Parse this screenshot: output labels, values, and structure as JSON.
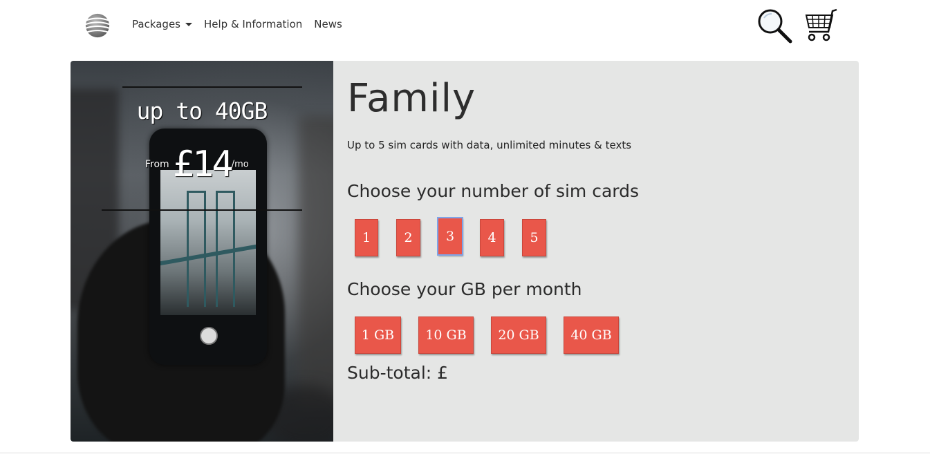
{
  "nav": {
    "logo": "att-globe-logo",
    "links": [
      {
        "label": "Packages",
        "has_dropdown": true
      },
      {
        "label": "Help & Information",
        "has_dropdown": false
      },
      {
        "label": "News",
        "has_dropdown": false
      }
    ],
    "icons": [
      "search-icon",
      "cart-icon"
    ]
  },
  "hero": {
    "headline": "up to 40GB",
    "from_label": "From",
    "price": "£14",
    "per_label": "/mo"
  },
  "plan": {
    "title": "Family",
    "subtitle": "Up to 5 sim cards with data, unlimited minutes & texts",
    "sim_heading": "Choose your number of sim cards",
    "sim_options": [
      "1",
      "2",
      "3",
      "4",
      "5"
    ],
    "sim_selected": "3",
    "gb_heading": "Choose your GB per month",
    "gb_options": [
      "1 GB",
      "10 GB",
      "20 GB",
      "40 GB"
    ],
    "subtotal": "Sub-total: £"
  },
  "colors": {
    "button": "#e9574a",
    "panel": "#e5e6e5",
    "selected_outline": "#7fa4e8"
  }
}
